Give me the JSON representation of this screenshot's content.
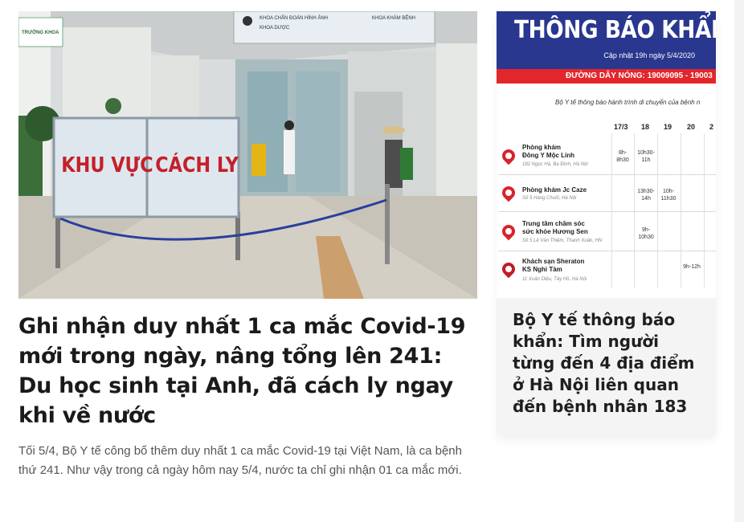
{
  "main_story": {
    "image_alt": "Khu vực cách ly trong bệnh viện",
    "image_sign": {
      "word1": "KHU VỰC",
      "word2": "CÁCH LY",
      "overhead_sign": [
        "KHOA CHẨN ĐOÁN HÌNH ẢNH",
        "KHOA KHÁM BỆNH",
        "KHOA DƯỢC"
      ],
      "door_sign": "TRƯỞNG KHOA"
    },
    "headline": "Ghi nhận duy nhất 1 ca mắc Covid-19 mới trong ngày, nâng tổng lên 241: Du học sinh tại Anh, đã cách ly ngay khi về nước",
    "summary": "Tối 5/4, Bộ Y tế công bố thêm duy nhất 1 ca mắc Covid-19 tại Việt Nam, là ca bệnh thứ 241. Như vậy trong cả ngày hôm nay 5/4, nước ta chỉ ghi nhận 01 ca mắc mới."
  },
  "side_story": {
    "notice": {
      "title": "THÔNG BÁO KHẨN",
      "updated": "Cập nhật 19h ngày 5/4/2020",
      "hotline": "ĐƯỜNG DÂY NÓNG: 19009095 - 19003",
      "intro": "Bộ Y tế thông báo hành trình di chuyển của bệnh n",
      "dates": [
        "17/3",
        "18",
        "19",
        "20",
        "2"
      ],
      "places": [
        {
          "name": "Phòng khám\nĐông Y Mộc Linh",
          "addr": "182 Ngọc Hà, Ba Đình, Hà Nội",
          "times": [
            "8h-\n8h30",
            "10h30-\n11h",
            "",
            ""
          ]
        },
        {
          "name": "Phòng khám Jc Caze",
          "addr": "Số 5 Hàng Chuối, Hà Nội",
          "times": [
            "",
            "13h30-\n14h",
            "10h-\n11h30",
            ""
          ]
        },
        {
          "name": "Trung tâm chăm sóc\nsức khỏe Hương Sen",
          "addr": "Số 5 Lê Văn Thiêm, Thanh Xuân, HN",
          "times": [
            "",
            "9h-\n10h30",
            "",
            ""
          ]
        },
        {
          "name": "Khách sạn Sheraton\nKS Nghi Tàm",
          "addr": "11 Xuân Diệu, Tây Hồ, Hà Nội",
          "times": [
            "",
            "",
            "",
            "9h-12h"
          ]
        }
      ]
    },
    "title": "Bộ Y tế thông báo khẩn: Tìm người từng đến 4 địa điểm ở Hà Nội liên quan đến bệnh nhân 183"
  },
  "colors": {
    "notice_blue": "#29378f",
    "notice_red": "#e3262b",
    "pin_red": "#d9232a"
  }
}
